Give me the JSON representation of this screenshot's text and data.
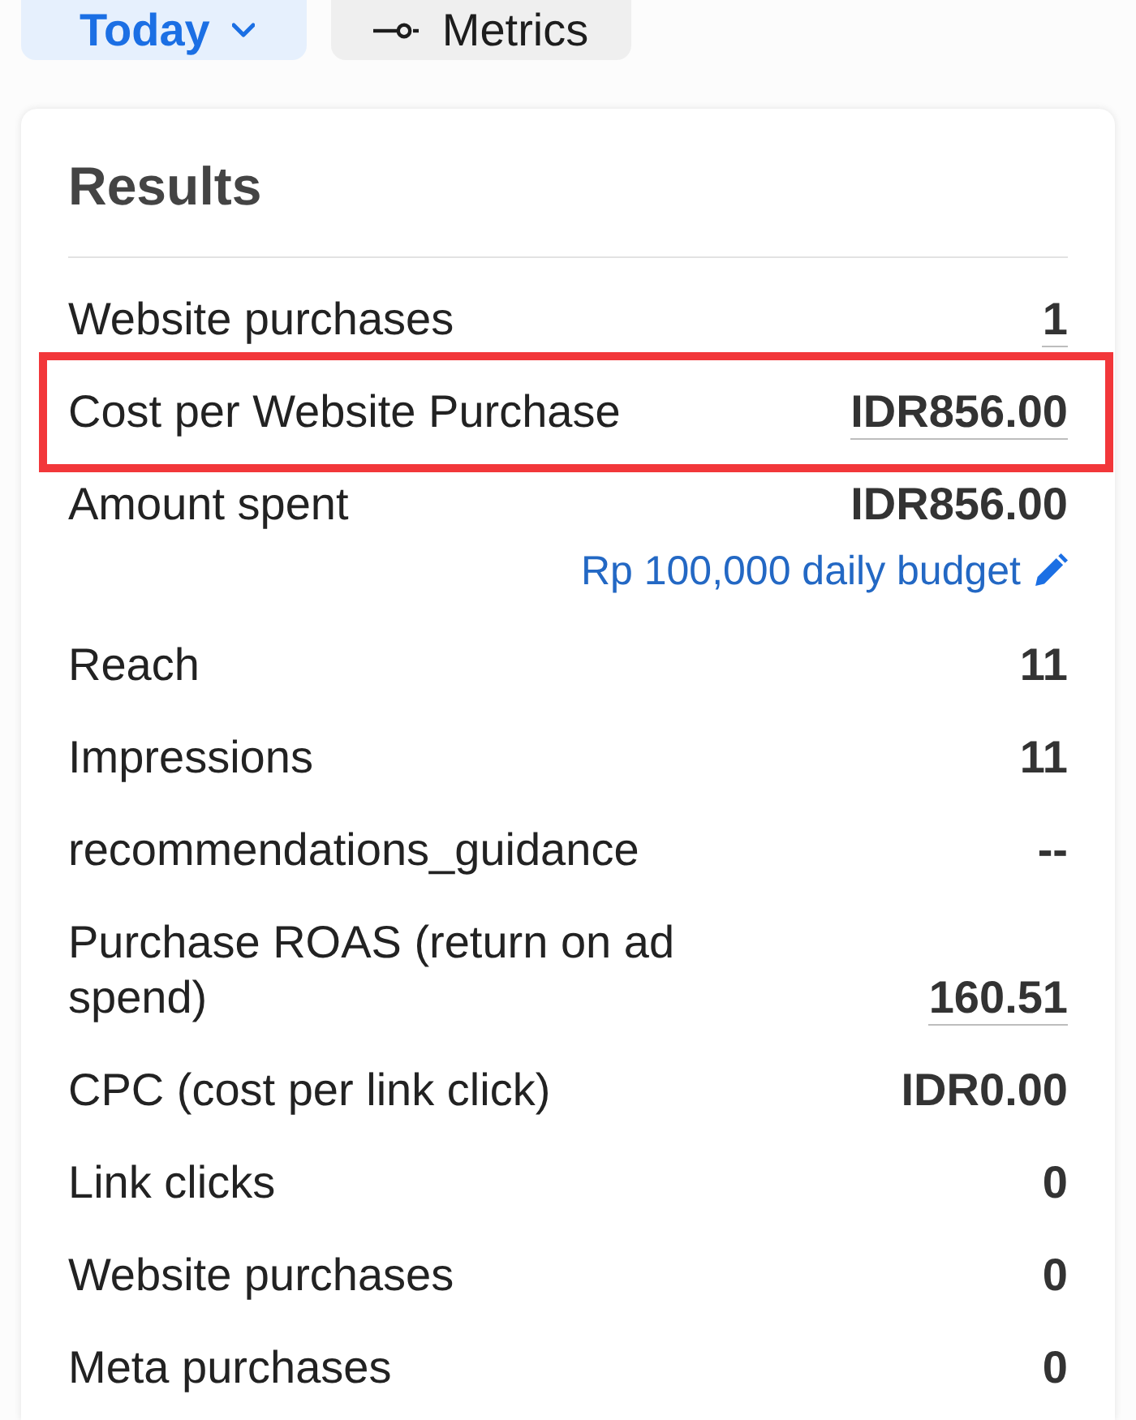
{
  "filters": [
    {
      "label": "Today",
      "kind": "dropdown",
      "selected": true
    },
    {
      "label": "Metrics",
      "kind": "settings",
      "selected": false
    }
  ],
  "results": {
    "title": "Results",
    "rows": [
      {
        "label": "Website purchases",
        "value": "1",
        "underlined": true,
        "highlighted": false
      },
      {
        "label": "Cost per Website Purchase",
        "value": "IDR856.00",
        "underlined": true,
        "highlighted": true
      },
      {
        "label": "Amount spent",
        "value": "IDR856.00",
        "underlined": false,
        "highlighted": false,
        "budget_link": "Rp 100,000 daily budget"
      },
      {
        "label": "Reach",
        "value": "11",
        "underlined": false,
        "highlighted": false
      },
      {
        "label": "Impressions",
        "value": "11",
        "underlined": false,
        "highlighted": false
      },
      {
        "label": "recommendations_guidance",
        "value": "--",
        "underlined": false,
        "highlighted": false
      },
      {
        "label": "Purchase ROAS (return on ad spend)",
        "value": "160.51",
        "underlined": true,
        "highlighted": false
      },
      {
        "label": "CPC (cost per link click)",
        "value": "IDR0.00",
        "underlined": false,
        "highlighted": false
      },
      {
        "label": "Link clicks",
        "value": "0",
        "underlined": false,
        "highlighted": false
      },
      {
        "label": "Website purchases",
        "value": "0",
        "underlined": false,
        "highlighted": false
      },
      {
        "label": "Meta purchases",
        "value": "0",
        "underlined": false,
        "highlighted": false
      }
    ]
  }
}
